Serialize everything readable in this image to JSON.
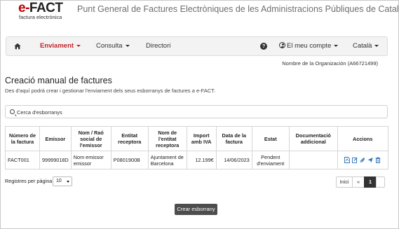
{
  "logo": {
    "main_prefix": "e-",
    "main_fact": "FACT",
    "sub": "factura electrònica"
  },
  "site_title": "Punt General de Factures Electròniques de les Administracions Públiques de Catalunya",
  "nav": {
    "home_icon": "home-icon",
    "enviament": "Enviament",
    "consulta": "Consulta",
    "directori": "Directori",
    "help_icon": "question-circle-icon",
    "account": "El meu compte",
    "language": "Català"
  },
  "org": "Nombre de la Organización (A66721499)",
  "page": {
    "title": "Creació manual de factures",
    "subtitle": "Des d'aquí podrà crear i gestionar l'enviament dels seus esborranys de factures a e-FACT."
  },
  "search": {
    "placeholder": "Cerca d'esborranys",
    "value": ""
  },
  "table": {
    "headers": [
      "Número de la factura",
      "Emissor",
      "Nom / Raó social de l'emissor",
      "Entitat receptora",
      "Nom de l'entitat receptora",
      "Import amb IVA",
      "Data de la factura",
      "Estat",
      "Documentació addicional",
      "Accions"
    ],
    "rows": [
      {
        "numero": "FACT001",
        "emissor": "99999018D",
        "nom_emissor": "Nom emissor emissor",
        "entitat": "P0801900B",
        "nom_entitat": "Ajuntament de Barcelona",
        "import": "12.199€",
        "data": "14/06/2023",
        "estat": "Pendent d'enviament",
        "doc": ""
      }
    ],
    "action_icons": [
      "pdf-icon",
      "edit-icon",
      "attach-icon",
      "send-icon",
      "trash-icon"
    ]
  },
  "per_page": {
    "label": "Registres per pàgina:",
    "value": "10"
  },
  "pagination": {
    "start": "Inici",
    "prev": "«",
    "current": "1",
    "next": ""
  },
  "create_button": "Crear esborrany",
  "colors": {
    "brand_red": "#c0252d",
    "dark_button": "#4d4d4d",
    "icon_blue": "#2a6fb8"
  }
}
